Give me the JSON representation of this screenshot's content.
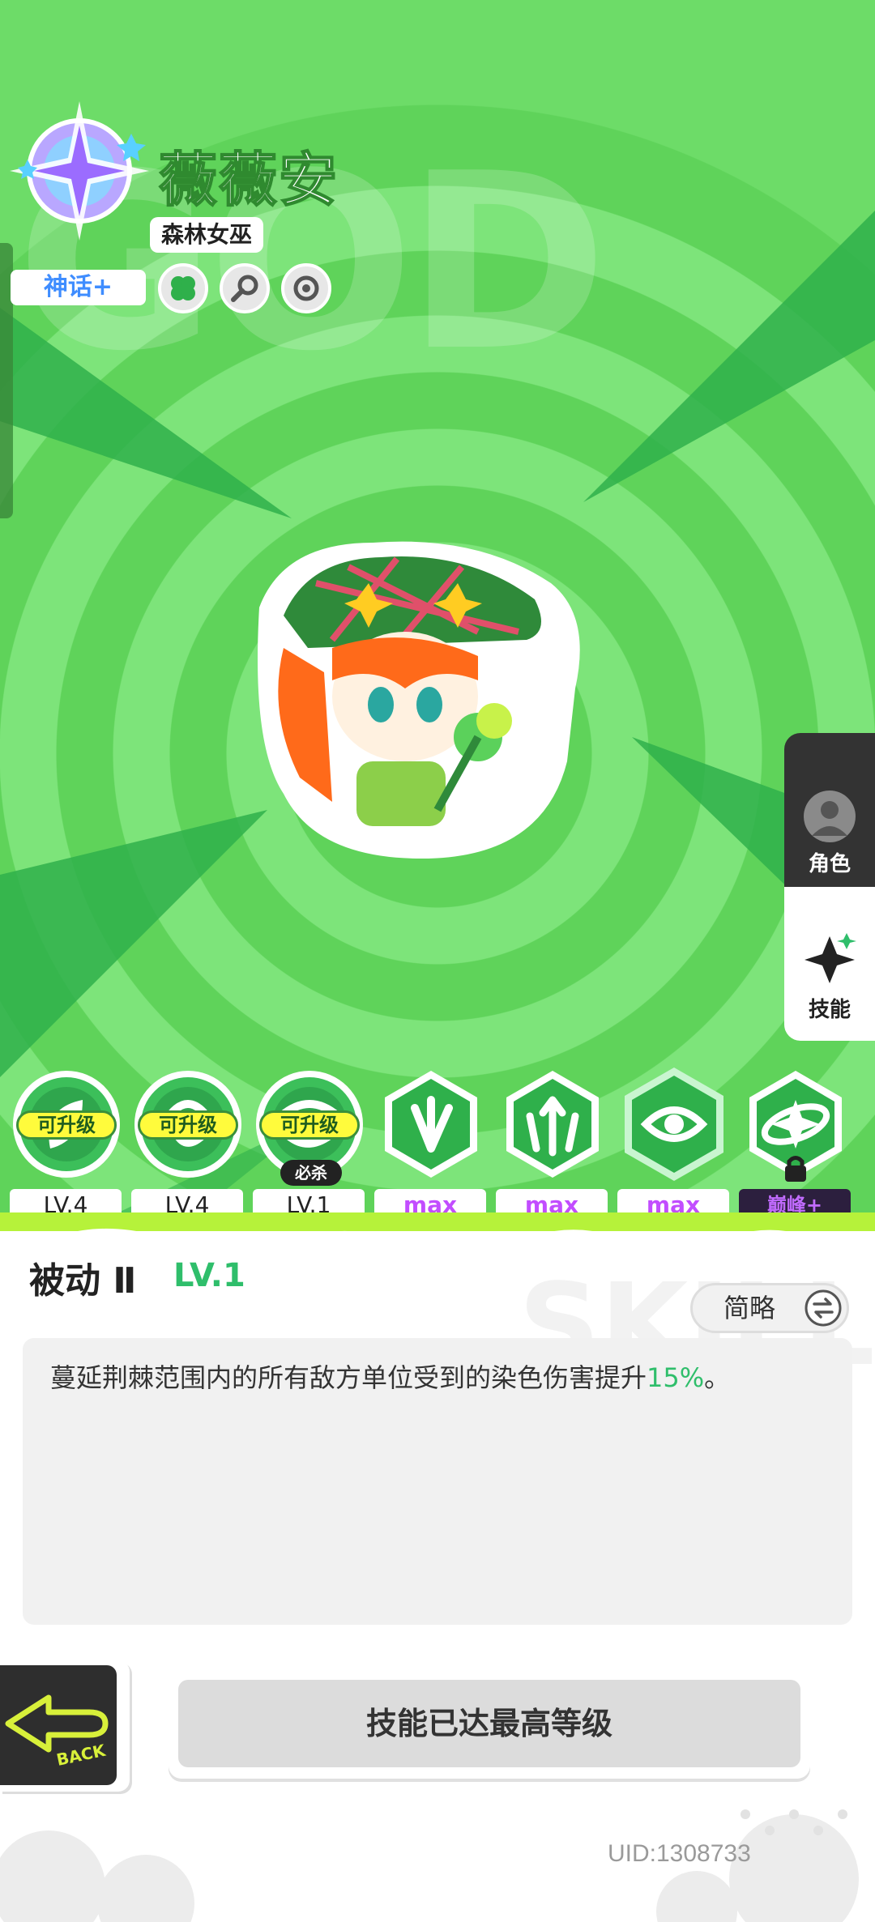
{
  "header": {
    "character_name": "薇薇安",
    "character_title": "森林女巫",
    "rarity": "神话+",
    "attribute_icons": [
      "clover-icon",
      "magnifier-icon",
      "cycle-icon"
    ]
  },
  "side_tabs": [
    {
      "label": "角色",
      "icon": "avatar-icon",
      "active": false
    },
    {
      "label": "技能",
      "icon": "sparkle-icon",
      "active": true
    }
  ],
  "skills": [
    {
      "icon": "leaf-skill-icon",
      "badge": "可升级",
      "level": "LV.4"
    },
    {
      "icon": "swirl-skill-icon",
      "badge": "可升级",
      "level": "LV.4"
    },
    {
      "icon": "thorn-skill-icon",
      "badge": "可升级",
      "tag": "必杀",
      "level": "LV.1"
    },
    {
      "icon": "burst-skill-icon",
      "level": "max"
    },
    {
      "icon": "arrows-skill-icon",
      "level": "max"
    },
    {
      "icon": "eye-skill-icon",
      "level": "max"
    },
    {
      "icon": "orbit-skill-icon",
      "level": "巅峰+",
      "locked": true
    }
  ],
  "detail": {
    "skill_name": "被动 Ⅱ",
    "skill_level": "LV.1",
    "toggle_label": "简略",
    "description_text": "蔓延荆棘范围内的所有敌方单位受到的染色伤害提升",
    "description_value": "15%",
    "description_end": "。"
  },
  "actions": {
    "back_label": "BACK",
    "main_button": "技能已达最高等级"
  },
  "footer": {
    "uid": "UID:1308733"
  },
  "colors": {
    "bg_green": "#5fd35a",
    "accent_green": "#2fbe6b",
    "max_purple": "#c24dff",
    "rarity_blue": "#3f8dff",
    "badge_yellow": "#fffb3c"
  }
}
